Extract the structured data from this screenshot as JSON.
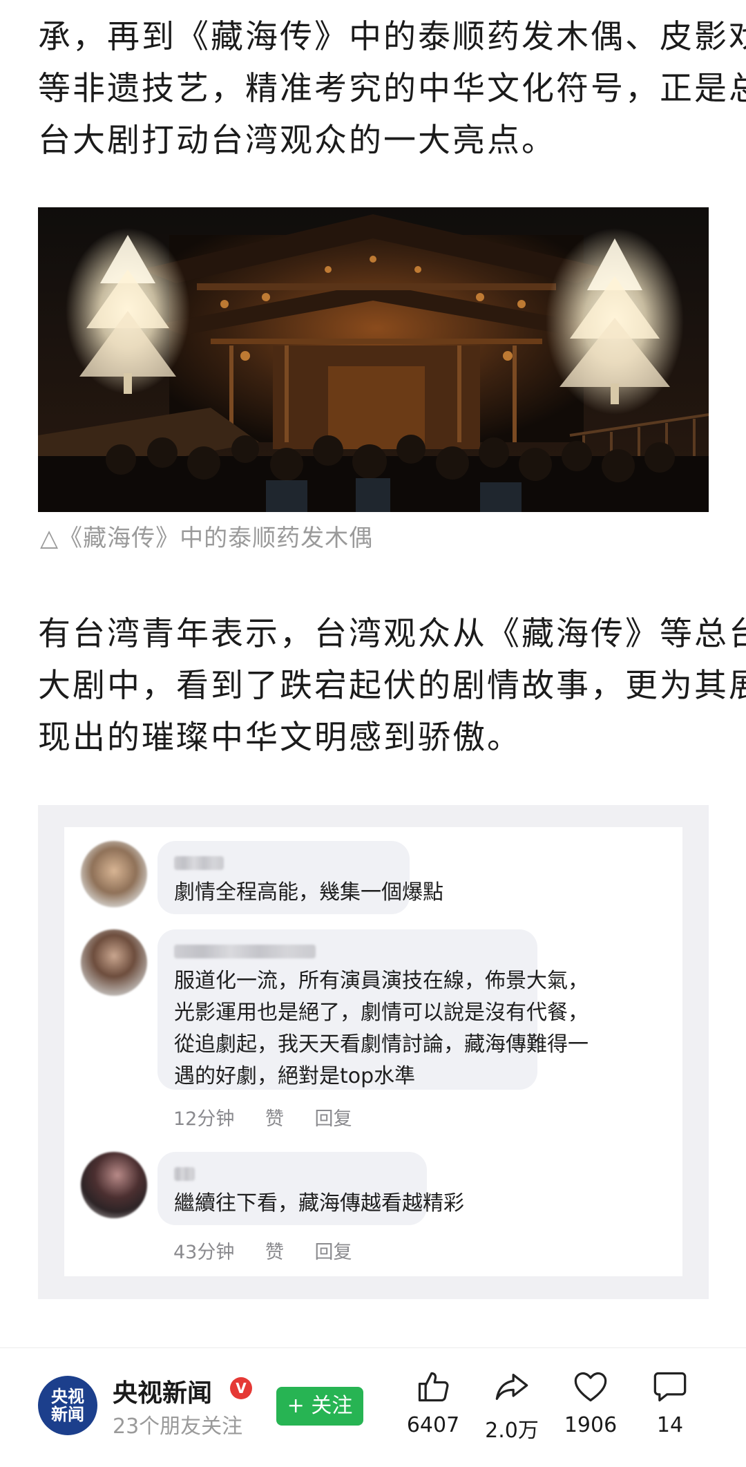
{
  "article": {
    "para1_lines": [
      "承，再到《藏海传》中的泰顺药发木偶、皮影戏",
      "等非遗技艺，精准考究的中华文化符号，正是总",
      "台大剧打动台湾观众的一大亮点。"
    ],
    "caption": "△《藏海传》中的泰顺药发木偶",
    "para2_lines": [
      "有台湾青年表示，台湾观众从《藏海传》等总台",
      "大剧中，看到了跌宕起伏的剧情故事，更为其展",
      "现出的璀璨中华文明感到骄傲。"
    ]
  },
  "comments": [
    {
      "lines": [
        "劇情全程高能，幾集一個爆點"
      ],
      "time": "",
      "like": "",
      "reply": ""
    },
    {
      "lines": [
        "服道化一流，所有演員演技在線，佈景大氣，",
        "光影運用也是絕了，劇情可以說是沒有代餐，",
        "從追劇起，我天天看劇情討論，藏海傳難得一",
        "遇的好劇，絕對是top水準"
      ],
      "time": "12分钟",
      "like": "赞",
      "reply": "回复"
    },
    {
      "lines": [
        "繼續往下看，藏海傳越看越精彩"
      ],
      "time": "43分钟",
      "like": "赞",
      "reply": "回复"
    }
  ],
  "footer": {
    "logo_line1": "央视",
    "logo_line2": "新闻",
    "account_name": "央视新闻",
    "verified_mark": "V",
    "followers_text": "23个朋友关注",
    "follow_label": "+ 关注",
    "like_count": "6407",
    "share_count": "2.0万",
    "favorite_count": "1906",
    "comment_count": "14",
    "accent_color": "#27b453",
    "icons": [
      "thumbs-up-icon",
      "share-arrow-icon",
      "heart-icon",
      "comment-bubble-icon"
    ]
  }
}
